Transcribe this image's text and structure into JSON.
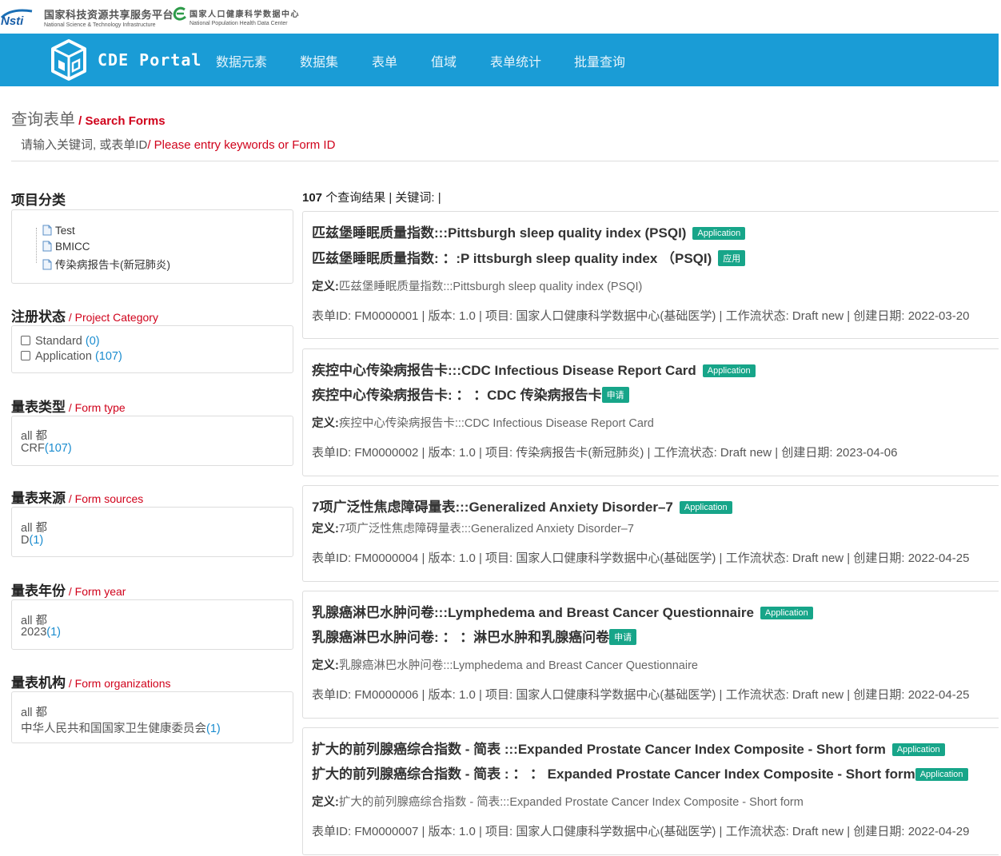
{
  "header": {
    "nsti_name_cn": "国家科技资源共享服务平台",
    "nsti_name_en": "National Science & Technology Infrastructure",
    "nphd_name_cn": "国家人口健康科学数据中心",
    "nphd_name_en": "National Population Health Data Center"
  },
  "nav": {
    "portal_name": "CDE Portal",
    "items": [
      "数据元素",
      "数据集",
      "表单",
      "值域",
      "表单统计",
      "批量查询"
    ]
  },
  "page": {
    "title_cn": "查询表单",
    "title_en": " / Search Forms",
    "search_hint_cn": "请输入关键词, 或表单ID",
    "search_hint_en": "/ Please entry keywords or Form ID"
  },
  "sidebar": {
    "project": {
      "title": "项目分类",
      "items": [
        "Test",
        "BMICC",
        "传染病报告卡(新冠肺炎)"
      ]
    },
    "status": {
      "title_cn": "注册状态",
      "title_en": " / Project Category",
      "options": [
        {
          "label": "Standard ",
          "count": "(0)"
        },
        {
          "label": "Application ",
          "count": "(107)"
        }
      ]
    },
    "form_type": {
      "title_cn": "量表类型",
      "title_en": " / Form type",
      "all": "all 都",
      "option_label": "CRF",
      "option_count": "(107)"
    },
    "form_sources": {
      "title_cn": "量表来源",
      "title_en": " / Form sources",
      "all": "all 都",
      "option_label": "D",
      "option_count": "(1)"
    },
    "form_year": {
      "title_cn": "量表年份",
      "title_en": " / Form year",
      "all": "all 都",
      "option_label": "2023",
      "option_count": "(1)"
    },
    "form_orgs": {
      "title_cn": "量表机构",
      "title_en": " / Form organizations",
      "all": "all 都",
      "option_label": "中华人民共和国国家卫生健康委员会",
      "option_count": "(1)"
    }
  },
  "results": {
    "count": "107",
    "summary_rest": " 个查询结果 | 关键词: |",
    "def_label": "定义:",
    "cards": [
      {
        "title": "匹兹堡睡眠质量指数:::Pittsburgh sleep quality index (PSQI)",
        "badge": "Application",
        "subtitle": "匹兹堡睡眠质量指数: ：:P ittsburgh sleep quality index （PSQI)",
        "subbadge": "应用",
        "definition": "匹兹堡睡眠质量指数:::Pittsburgh sleep quality index (PSQI)",
        "meta": "表单ID: FM0000001 | 版本: 1.0 | 项目: 国家人口健康科学数据中心(基础医学) | 工作流状态: Draft new | 创建日期: 2022-03-20"
      },
      {
        "title": "疾控中心传染病报告卡:::CDC Infectious Disease Report Card",
        "badge": "Application",
        "subtitle": "疾控中心传染病报告卡: ： ：CDC 传染病报告卡",
        "subbadge": "申请",
        "definition": "疾控中心传染病报告卡:::CDC Infectious Disease Report Card",
        "meta": "表单ID: FM0000002 | 版本: 1.0 | 项目: 传染病报告卡(新冠肺炎) | 工作流状态: Draft new | 创建日期: 2023-04-06"
      },
      {
        "title": "7项广泛性焦虑障碍量表:::Generalized Anxiety Disorder–7",
        "badge": "Application",
        "definition": "7项广泛性焦虑障碍量表:::Generalized Anxiety Disorder–7",
        "meta": "表单ID: FM0000004 | 版本: 1.0 | 项目: 国家人口健康科学数据中心(基础医学) | 工作流状态: Draft new | 创建日期: 2022-04-25"
      },
      {
        "title": "乳腺癌淋巴水肿问卷:::Lymphedema and Breast Cancer Questionnaire",
        "badge": "Application",
        "subtitle": "乳腺癌淋巴水肿问卷: ： ：淋巴水肿和乳腺癌问卷",
        "subbadge": "申请",
        "definition": "乳腺癌淋巴水肿问卷:::Lymphedema and Breast Cancer Questionnaire",
        "meta": "表单ID: FM0000006 | 版本: 1.0 | 项目: 国家人口健康科学数据中心(基础医学) | 工作流状态: Draft new | 创建日期: 2022-04-25"
      },
      {
        "title": "扩大的前列腺癌综合指数 - 简表 :::Expanded Prostate Cancer Index Composite - Short form",
        "badge": "Application",
        "subtitle": "扩大的前列腺癌综合指数 - 简表 : ： ： Expanded Prostate Cancer Index Composite - Short form",
        "subbadge": "Application",
        "definition": "扩大的前列腺癌综合指数 - 简表:::Expanded Prostate Cancer Index Composite - Short form",
        "meta": "表单ID: FM0000007 | 版本: 1.0 | 项目: 国家人口健康科学数据中心(基础医学) | 工作流状态: Draft new | 创建日期: 2022-04-29"
      }
    ]
  },
  "colors": {
    "nav_bg": "#1a9cd6",
    "accent_red": "#d0021b",
    "badge_green": "#17a589",
    "count_blue": "#1a8ccf"
  }
}
